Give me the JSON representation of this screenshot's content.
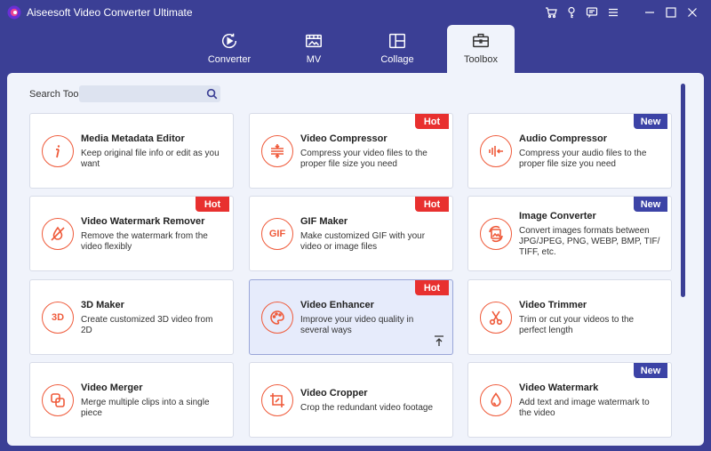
{
  "app": {
    "title": "Aiseesoft Video Converter Ultimate"
  },
  "window_controls": [
    "cart-icon",
    "key-icon",
    "feedback-icon",
    "menu-icon",
    "minimize-icon",
    "maximize-icon",
    "close-icon"
  ],
  "tabs": [
    {
      "label": "Converter",
      "icon": "converter-icon"
    },
    {
      "label": "MV",
      "icon": "mv-icon"
    },
    {
      "label": "Collage",
      "icon": "collage-icon"
    },
    {
      "label": "Toolbox",
      "icon": "toolbox-icon",
      "active": true
    }
  ],
  "search": {
    "label": "Search Tool:",
    "value": "",
    "placeholder": ""
  },
  "colors": {
    "accent": "#ef5a3a",
    "brand": "#3b3f95",
    "hot": "#e8302f",
    "new": "#3c43a6"
  },
  "badges": {
    "hot": "Hot",
    "new": "New"
  },
  "tools": [
    {
      "title": "Media Metadata Editor",
      "desc": "Keep original file info or edit as you want",
      "icon": "info-icon"
    },
    {
      "title": "Video Compressor",
      "desc": "Compress your video files to the proper file size you need",
      "icon": "compress-icon",
      "badge": "Hot"
    },
    {
      "title": "Audio Compressor",
      "desc": "Compress your audio files to the proper file size you need",
      "icon": "audio-compress-icon",
      "badge": "New"
    },
    {
      "title": "Video Watermark Remover",
      "desc": "Remove the watermark from the video flexibly",
      "icon": "watermark-remove-icon",
      "badge": "Hot"
    },
    {
      "title": "GIF Maker",
      "desc": "Make customized GIF with your video or image files",
      "icon": "gif-icon",
      "icon_text": "GIF",
      "badge": "Hot"
    },
    {
      "title": "Image Converter",
      "desc": "Convert images formats between JPG/JPEG, PNG, WEBP, BMP, TIF/ TIFF, etc.",
      "icon": "image-convert-icon",
      "badge": "New"
    },
    {
      "title": "3D Maker",
      "desc": "Create customized 3D video from 2D",
      "icon": "3d-icon",
      "icon_text": "3D"
    },
    {
      "title": "Video Enhancer",
      "desc": "Improve your video quality in several ways",
      "icon": "palette-icon",
      "badge": "Hot",
      "selected": true
    },
    {
      "title": "Video Trimmer",
      "desc": "Trim or cut your videos to the perfect length",
      "icon": "scissors-icon"
    },
    {
      "title": "Video Merger",
      "desc": "Merge multiple clips into a single piece",
      "icon": "merge-icon"
    },
    {
      "title": "Video Cropper",
      "desc": "Crop the redundant video footage",
      "icon": "crop-icon"
    },
    {
      "title": "Video Watermark",
      "desc": "Add text and image watermark to the video",
      "icon": "droplet-icon",
      "badge": "New"
    }
  ]
}
